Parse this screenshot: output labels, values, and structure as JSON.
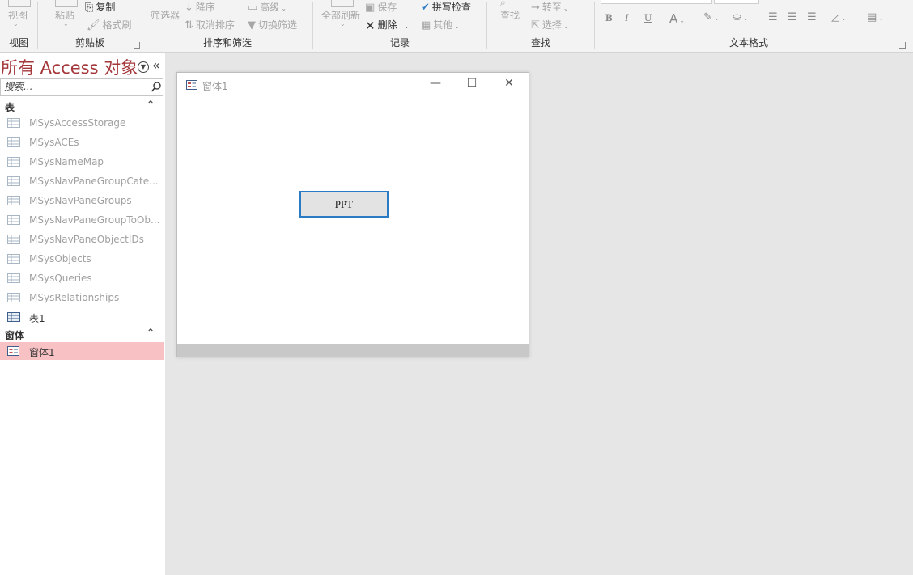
{
  "ribbon": {
    "groups": {
      "view": {
        "button": "视图",
        "label": "视图"
      },
      "clipboard": {
        "paste": "粘贴",
        "copy": "复制",
        "format_painter": "格式刷",
        "label": "剪贴板"
      },
      "sort_filter": {
        "filter": "筛选器",
        "descending": "降序",
        "advanced": "高级",
        "remove_sort": "取消排序",
        "toggle_filter": "切换筛选",
        "label": "排序和筛选"
      },
      "records": {
        "refresh_all": "全部刷新",
        "save": "保存",
        "spelling": "拼写检查",
        "delete": "删除",
        "more": "其他",
        "label": "记录"
      },
      "find": {
        "find": "查找",
        "goto": "转至",
        "select": "选择",
        "label": "查找"
      },
      "text_format": {
        "bold": "B",
        "italic": "I",
        "underline": "U",
        "font_color": "A",
        "label": "文本格式"
      }
    }
  },
  "nav": {
    "title": "所有 Access 对象",
    "collapse": "«",
    "search_placeholder": "搜索...",
    "sections": [
      {
        "label": "表",
        "chevron": "⌃",
        "items": [
          "MSysAccessStorage",
          "MSysACEs",
          "MSysNameMap",
          "MSysNavPaneGroupCate...",
          "MSysNavPaneGroups",
          "MSysNavPaneGroupToOb...",
          "MSysNavPaneObjectIDs",
          "MSysObjects",
          "MSysQueries",
          "MSysRelationships",
          "表1"
        ]
      },
      {
        "label": "窗体",
        "chevron": "⌃",
        "items": [
          "窗体1"
        ]
      }
    ]
  },
  "form_window": {
    "title": "窗体1",
    "minimize": "—",
    "maximize": "☐",
    "close": "✕",
    "button_label": "PPT"
  },
  "colors": {
    "accent": "#a4373a",
    "selected_item": "#f8c2c5",
    "button_focus": "#2a7ac4"
  }
}
